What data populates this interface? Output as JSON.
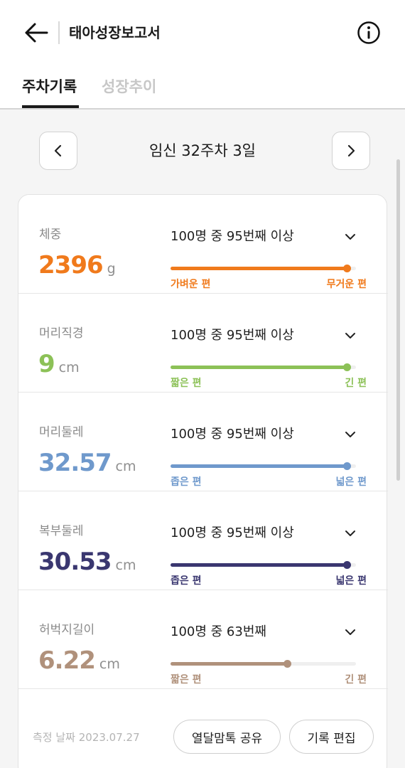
{
  "header": {
    "title": "태아성장보고서",
    "back_icon": "arrow-left-icon",
    "info_icon": "info-circle-icon"
  },
  "tabs": [
    {
      "label": "주차기록",
      "active": true
    },
    {
      "label": "성장추이",
      "active": false
    }
  ],
  "week_nav": {
    "label": "임신 32주차 3일",
    "prev_icon": "chevron-left-icon",
    "next_icon": "chevron-right-icon"
  },
  "metrics": [
    {
      "name": "체중",
      "value": "2396",
      "unit": "g",
      "rank": "100명 중 95번째 이상",
      "percentile": 0.95,
      "low_label": "가벼운 편",
      "high_label": "무거운 편",
      "color": "#f07a1c"
    },
    {
      "name": "머리직경",
      "value": "9",
      "unit": "cm",
      "rank": "100명 중 95번째 이상",
      "percentile": 0.95,
      "low_label": "짧은 편",
      "high_label": "긴 편",
      "color": "#8cc157"
    },
    {
      "name": "머리둘레",
      "value": "32.57",
      "unit": "cm",
      "rank": "100명 중 95번째 이상",
      "percentile": 0.95,
      "low_label": "좁은 편",
      "high_label": "넓은 편",
      "color": "#6f99cc"
    },
    {
      "name": "복부둘레",
      "value": "30.53",
      "unit": "cm",
      "rank": "100명 중 95번째 이상",
      "percentile": 0.95,
      "low_label": "좁은 편",
      "high_label": "넓은 편",
      "color": "#3a3770"
    },
    {
      "name": "허벅지길이",
      "value": "6.22",
      "unit": "cm",
      "rank": "100명 중 63번째",
      "percentile": 0.63,
      "low_label": "짧은 편",
      "high_label": "긴 편",
      "color": "#b0917b"
    }
  ],
  "footer": {
    "measure_date": "측정 날짜 2023.07.27",
    "share_label": "열달맘톡 공유",
    "edit_label": "기록 편집"
  }
}
